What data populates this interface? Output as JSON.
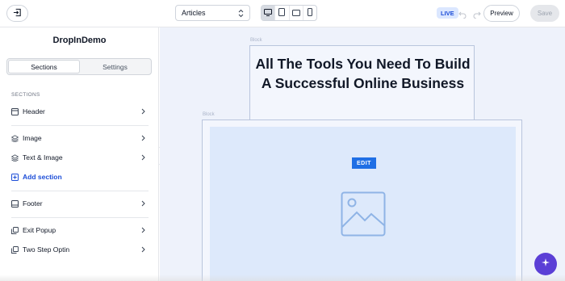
{
  "topbar": {
    "page_select_value": "Articles",
    "live_badge": "LIVE",
    "preview_label": "Preview",
    "save_label": "Save",
    "device_icons": [
      "desktop-icon",
      "tablet-icon",
      "tablet-landscape-icon",
      "mobile-icon"
    ]
  },
  "sidebar": {
    "site_title": "DropInDemo",
    "tabs": [
      {
        "label": "Sections",
        "active": true
      },
      {
        "label": "Settings",
        "active": false
      }
    ],
    "section_heading": "SECTIONS",
    "items": [
      {
        "label": "Header",
        "icon": "header-layout-icon"
      },
      {
        "label": "Image",
        "icon": "layers-icon"
      },
      {
        "label": "Text & Image",
        "icon": "layers-icon"
      },
      {
        "label": "Add section",
        "icon": "plus-square-icon"
      },
      {
        "label": "Footer",
        "icon": "footer-layout-icon"
      },
      {
        "label": "Exit Popup",
        "icon": "popup-icon"
      },
      {
        "label": "Two Step Optin",
        "icon": "popup-icon"
      }
    ]
  },
  "canvas": {
    "block_label_1": "Block",
    "block_label_2": "Block",
    "headline": "All The Tools You Need To Build A Successful Online Business",
    "edit_label": "EDIT"
  },
  "colors": {
    "accent": "#1f6fe5",
    "live_bg": "#dbe7ff",
    "fab": "#5b3fd6",
    "canvas_bg": "#eef2fb"
  }
}
